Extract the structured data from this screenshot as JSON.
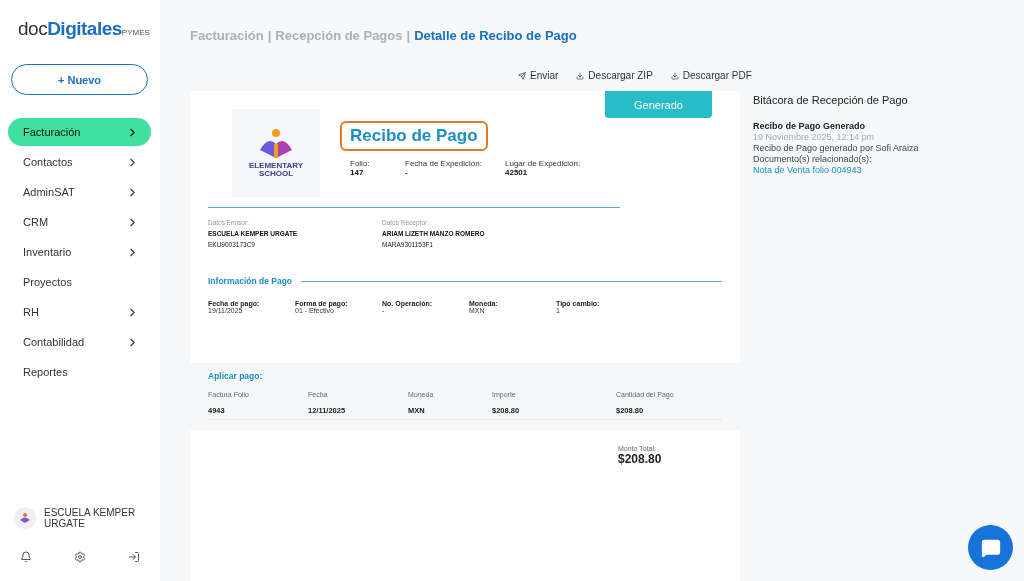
{
  "brand": {
    "prefix": "doc",
    "name": "Digitales",
    "suffix": "PYMES"
  },
  "new_button": {
    "icon": "+",
    "label": "Nuevo"
  },
  "sidebar": {
    "items": [
      {
        "label": "Facturación",
        "selected": true,
        "expandable": true
      },
      {
        "label": "Contactos",
        "selected": false,
        "expandable": true
      },
      {
        "label": "AdminSAT",
        "selected": false,
        "expandable": true
      },
      {
        "label": "CRM",
        "selected": false,
        "expandable": true
      },
      {
        "label": "Inventario",
        "selected": false,
        "expandable": true
      },
      {
        "label": "Proyectos",
        "selected": false,
        "expandable": false
      },
      {
        "label": "RH",
        "selected": false,
        "expandable": true
      },
      {
        "label": "Contabilidad",
        "selected": false,
        "expandable": true
      },
      {
        "label": "Reportes",
        "selected": false,
        "expandable": false
      }
    ],
    "account": "ESCUELA KEMPER URGATE"
  },
  "breadcrumb": [
    {
      "label": "Facturación",
      "current": false
    },
    {
      "separator": "|",
      "label": "Recepción de Pagos",
      "current": false
    },
    {
      "separator": "|",
      "label": "Detalle de Recibo de Pago",
      "current": true
    }
  ],
  "actions": [
    {
      "kind": "send",
      "label": "Enviar"
    },
    {
      "kind": "download",
      "label": "Descargar ZIP"
    },
    {
      "kind": "download",
      "label": "Descargar PDF"
    }
  ],
  "document": {
    "status": "Generado",
    "logo": {
      "line1": "ELEMENTARY",
      "line2": "SCHOOL"
    },
    "title": "Recibo de Pago",
    "header_fields": [
      {
        "label": "Folio:",
        "value": "147"
      },
      {
        "label": "Fecha de Expedición:",
        "value": "-"
      },
      {
        "label": "Lugar de Expedición:",
        "value": "42501"
      }
    ],
    "parties": [
      {
        "label": "Datos Emisor:",
        "name": "ESCUELA KEMPER URGATE",
        "rfc": "EKU9003173C9"
      },
      {
        "label": "Datos Receptor:",
        "name": "ARIAM LIZETH MANZO ROMERO",
        "rfc": "MARA9301153F1"
      }
    ],
    "payment_title": "Información de Pago",
    "payment_fields": [
      {
        "label": "Fecha de pago:",
        "value": "19/11/2025"
      },
      {
        "label": "Forma de pago:",
        "value": "01 - Efectivo"
      },
      {
        "label": "No. Operación:",
        "value": "-"
      },
      {
        "label": "Moneda:",
        "value": "MXN"
      },
      {
        "label": "Tipo cambio:",
        "value": "1"
      }
    ],
    "apply_title": "Aplicar pago:",
    "table": {
      "columns": [
        "Factura Folio",
        "Fecha",
        "Moneda",
        "Importe",
        "Cantidad del Pago"
      ],
      "rows": [
        [
          "4943",
          "12/11/2025",
          "MXN",
          "$208.80",
          "$208.80"
        ]
      ]
    },
    "total_label": "Monto Total:",
    "total": "$208.80"
  },
  "log": {
    "title": "Bitácora de Recepción de Pago",
    "entries": [
      {
        "title": "Recibo de Pago Generado",
        "time": "19 Noviembre 2025, 12:14 pm",
        "text": "Recibo de Pago generado por Sofi Araiza",
        "related_label": "Documento(s) relacionado(s):",
        "link": "Nota de Venta folio 004943"
      }
    ]
  }
}
